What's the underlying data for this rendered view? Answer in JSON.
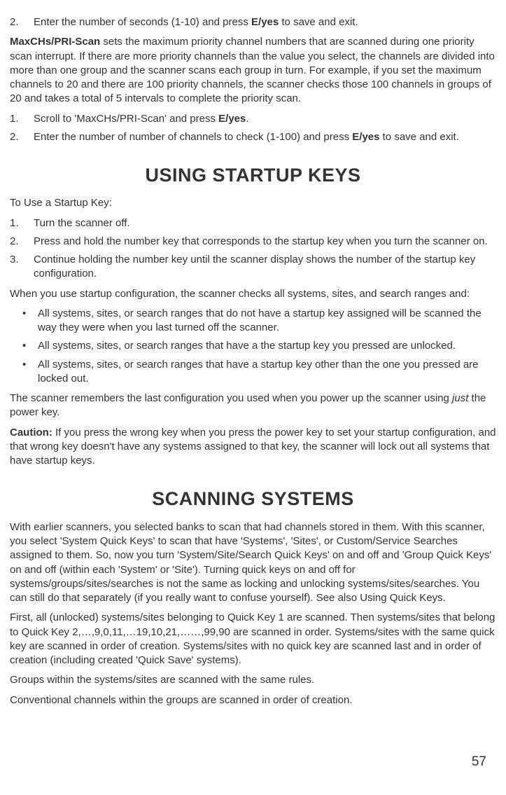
{
  "top": {
    "list1": {
      "num": "2.",
      "text_a": "Enter the number of seconds (1-10) and press ",
      "text_b": "E/yes",
      "text_c": " to save and exit."
    },
    "para1_a": "MaxCHs/PRI-Scan",
    "para1_b": " sets the maximum priority channel numbers that are scanned during one priority scan interrupt. If there are more priority channels than the value you select, the channels are divided into more than one group and the scanner scans each group in turn. For example, if you set the maximum channels to 20 and there are 100 priority channels, the scanner checks those 100 channels in groups of 20 and takes a total of 5 intervals to complete the priority scan.",
    "list2": [
      {
        "num": "1.",
        "a": "Scroll to 'MaxCHs/PRI-Scan' and press ",
        "b": "E/yes",
        "c": "."
      },
      {
        "num": "2.",
        "a": "Enter the number of number of channels to check (1-100) and press ",
        "b": "E/yes",
        "c": " to save and exit."
      }
    ]
  },
  "startup": {
    "heading": "USING STARTUP KEYS",
    "intro": "To Use a Startup Key:",
    "steps": [
      {
        "num": "1.",
        "text": "Turn the scanner off."
      },
      {
        "num": "2.",
        "text": "Press and hold the number key that corresponds to the startup key when you turn the scanner on."
      },
      {
        "num": "3.",
        "text": "Continue holding the number key until the scanner display shows the number of the startup key configuration."
      }
    ],
    "when": "When you use startup configuration, the scanner checks all systems, sites, and search ranges and:",
    "bullets": [
      "All systems, sites, or search ranges that do not have a startup key assigned will be scanned the way they were when you last turned off the scanner.",
      "All systems, sites, or search ranges that have a the startup key you pressed are unlocked.",
      "All systems, sites, or search ranges that have a startup key other than the one you pressed are locked out."
    ],
    "remember_a": "The scanner remembers the last configuration you used when you power up the scanner using ",
    "remember_b": "just",
    "remember_c": " the power key.",
    "caution_a": "Caution:",
    "caution_b": " If you press the wrong key when you press the power key to set your startup configuration, and that wrong key doesn't have any systems assigned to that key, the scanner will lock out all systems that have startup keys."
  },
  "scanning": {
    "heading": "SCANNING SYSTEMS",
    "p1": "With earlier scanners, you selected banks to scan that had channels stored in them. With this scanner, you select 'System Quick Keys' to scan that have 'Systems', 'Sites', or Custom/Service Searches assigned to them. So, now you turn 'System/Site/Search Quick Keys' on and off and 'Group Quick Keys' on and off (within each 'System' or 'Site'). Turning quick keys on and off for systems/groups/sites/searches is not the same as locking and unlocking systems/sites/searches. You can still do that separately (if you really want to confuse yourself). See also Using Quick Keys.",
    "p2": "First, all (unlocked) systems/sites belonging to Quick Key 1 are scanned. Then systems/sites that belong to Quick Key 2,…,9,0,11,…19,10,21,……,99,90 are scanned in order. Systems/sites with the same quick key are scanned in order of creation. Systems/sites with no quick key are scanned last and in order of creation (including created 'Quick Save' systems).",
    "p3": "Groups within the systems/sites are scanned with the same rules.",
    "p4": "Conventional channels within the groups are scanned in order of creation."
  },
  "page_number": "57"
}
